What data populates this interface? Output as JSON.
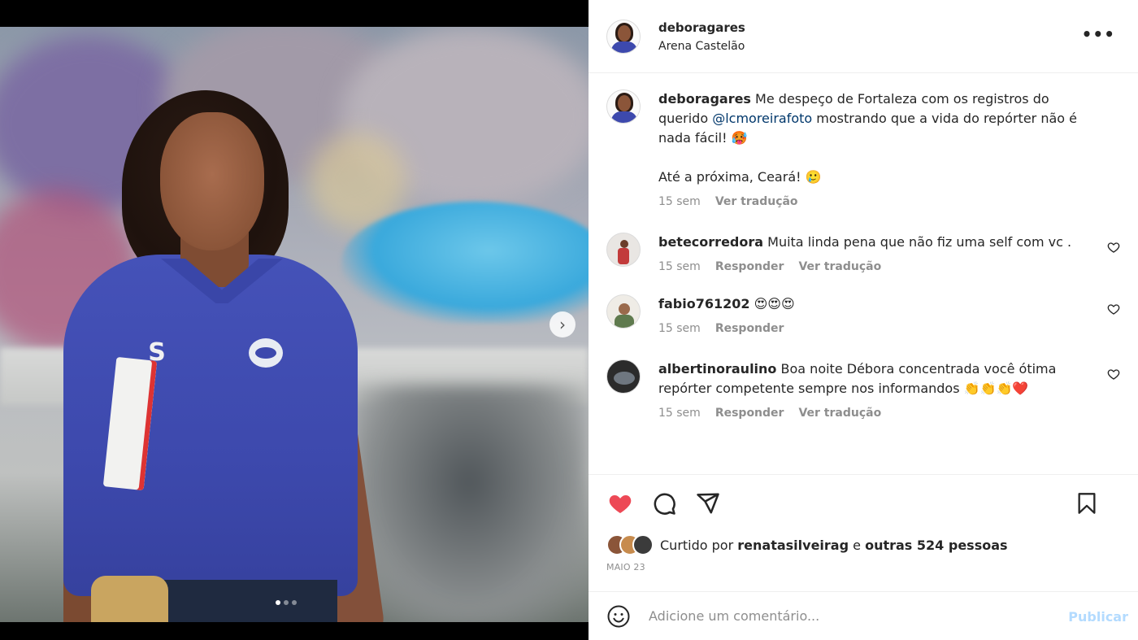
{
  "post": {
    "username": "deboragares",
    "location": "Arena Castelão",
    "more_icon": "more-horizontal-icon"
  },
  "caption": {
    "username": "deboragares",
    "text_part1": "Me despeço de Fortaleza com os registros do querido",
    "mention": "@lcmoreirafoto",
    "text_part2": "mostrando que a vida do repórter não é nada fácil!",
    "emoji1": "🥵",
    "line2": "Até a próxima, Ceará!",
    "emoji2": "🥲",
    "time": "15 sem",
    "translate": "Ver tradução"
  },
  "comments": [
    {
      "username": "betecorredora",
      "text": "Muita linda pena que não fiz uma self com vc .",
      "time": "15 sem",
      "reply": "Responder",
      "translate": "Ver tradução"
    },
    {
      "username": "fabio761202",
      "text": "😍😍😍",
      "time": "15 sem",
      "reply": "Responder"
    },
    {
      "username": "albertinoraulino",
      "text": "Boa noite Débora concentrada você ótima repórter competente sempre nos informandos 👏👏👏❤️",
      "time": "15 sem",
      "reply": "Responder",
      "translate": "Ver tradução"
    }
  ],
  "likes": {
    "prefix": "Curtido por",
    "user": "renatasilveirag",
    "connector": "e",
    "others": "outras 524 pessoas"
  },
  "date": "MAIO 23",
  "add_comment": {
    "placeholder": "Adicione um comentário...",
    "publish": "Publicar"
  },
  "carousel": {
    "next_icon": "chevron-right-icon",
    "total": 3,
    "active_index": 0
  },
  "colors": {
    "like_red": "#ed4956",
    "link_blue": "#00376b",
    "publish_disabled": "#b3dbff",
    "meta_gray": "#8e8e8e"
  }
}
